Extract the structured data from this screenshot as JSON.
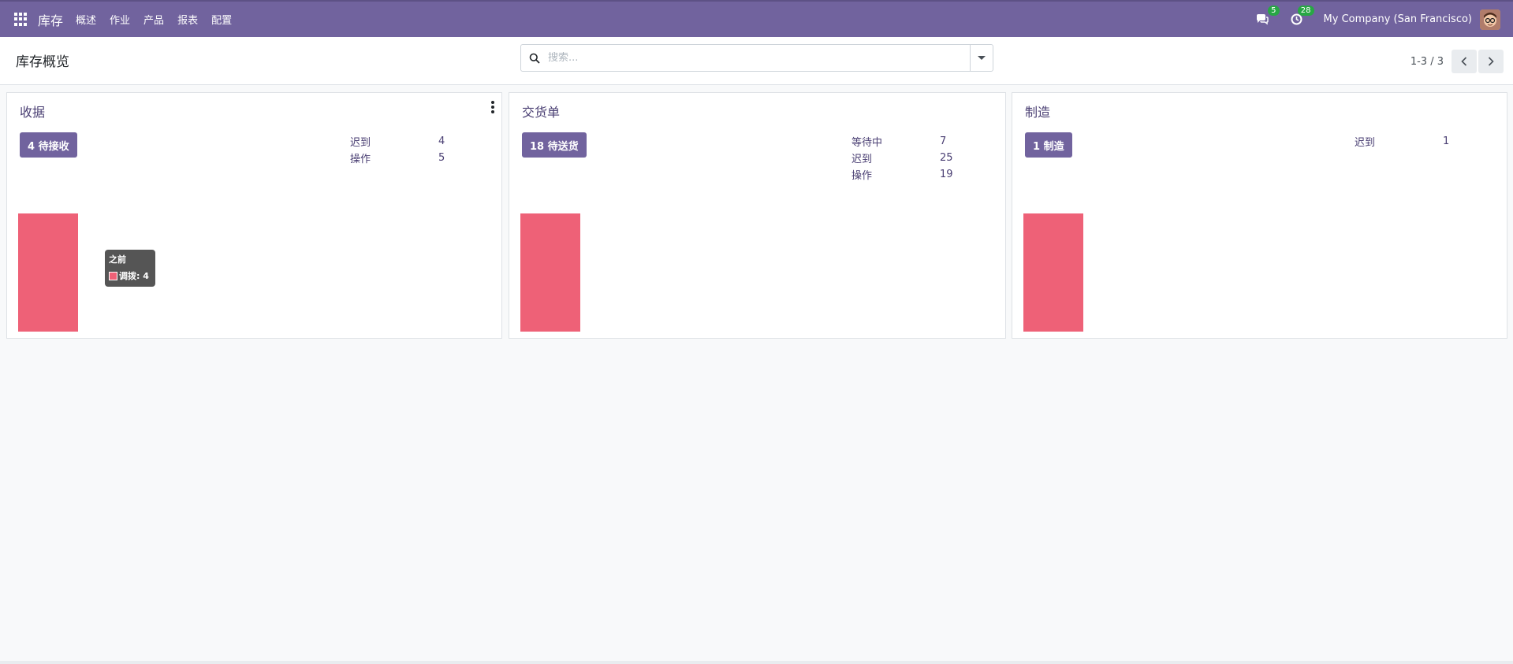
{
  "nav": {
    "brand": "库存",
    "menu": [
      "概述",
      "作业",
      "产品",
      "报表",
      "配置"
    ],
    "messages_badge": "5",
    "activity_badge": "28",
    "company": "My Company (San Francisco)"
  },
  "control": {
    "title": "库存概览",
    "search_placeholder": "搜索...",
    "pager": "1-3 / 3"
  },
  "cards": [
    {
      "title": "收据",
      "button": "4 待接收",
      "stats": [
        {
          "label": "迟到",
          "value": "4"
        },
        {
          "label": "操作",
          "value": "5"
        }
      ]
    },
    {
      "title": "交货单",
      "button": "18 待送货",
      "stats": [
        {
          "label": "等待中",
          "value": "7"
        },
        {
          "label": "迟到",
          "value": "25"
        },
        {
          "label": "操作",
          "value": "19"
        }
      ]
    },
    {
      "title": "制造",
      "button": "1 制造",
      "stats": [
        {
          "label": "迟到",
          "value": "1"
        }
      ]
    }
  ],
  "tooltip": {
    "title": "之前",
    "series": "调拨: 4"
  },
  "colors": {
    "primary": "#71639e",
    "bar": "#ee6177",
    "badge": "#28a745"
  }
}
